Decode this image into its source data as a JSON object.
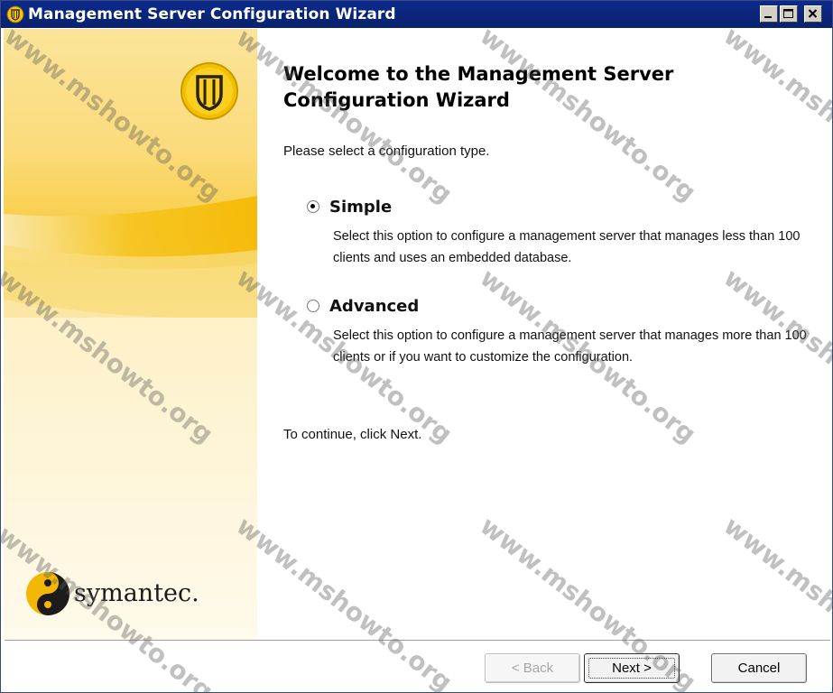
{
  "window": {
    "title": "Management Server Configuration Wizard"
  },
  "banner": {
    "brand_name": "symantec."
  },
  "content": {
    "heading": "Welcome to the Management Server Configuration Wizard",
    "prompt": "Please select a configuration type.",
    "options": [
      {
        "label": "Simple",
        "selected": true,
        "description": "Select this option to configure a management server that manages less than 100 clients and uses an embedded database."
      },
      {
        "label": "Advanced",
        "selected": false,
        "description": "Select this option to configure a management server that manages more than 100 clients or if you want to customize the configuration."
      }
    ],
    "continue_text": "To continue, click Next."
  },
  "buttons": {
    "back": "< Back",
    "next": "Next >",
    "cancel": "Cancel"
  },
  "watermark": {
    "text": "www.mshowto.org"
  },
  "icons": {
    "title_icon": "symantec-shield-icon",
    "logo": "symantec-shield-icon",
    "brand": "symantec-logo-icon"
  },
  "colors": {
    "titlebar": "#0a2478",
    "banner_yellow": "#f7c62a",
    "banner_light": "#fdf3cf"
  }
}
